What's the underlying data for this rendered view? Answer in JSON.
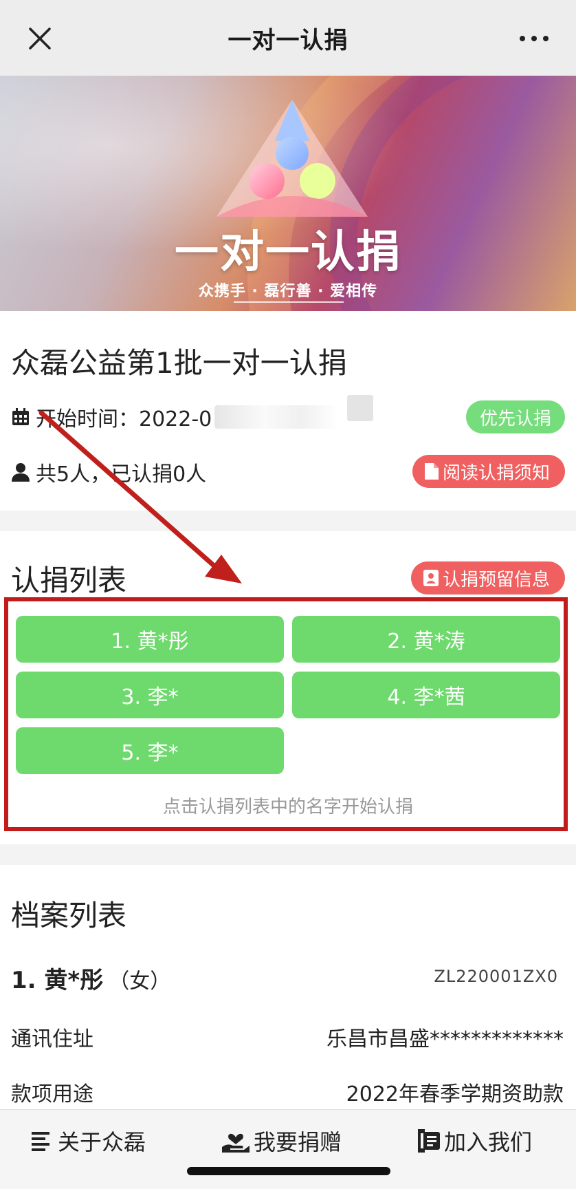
{
  "navbar": {
    "title": "一对一认捐"
  },
  "banner": {
    "title": "一对一认捐",
    "slogan": "众携手 · 磊行善 · 爱相传"
  },
  "info": {
    "title": "众磊公益第1批一对一认捐",
    "start_time_label": "开始时间：2022-0",
    "priority_badge": "优先认捐",
    "count_text": "共5人，已认捐0人",
    "read_button": "阅读认捐须知"
  },
  "subscription_list": {
    "title": "认捐列表",
    "reserve_button": "认捐预留信息",
    "items": [
      "1. 黄*彤",
      "2. 黄*涛",
      "3. 李*",
      "4. 李*茜",
      "5. 李*"
    ],
    "hint": "点击认捐列表中的名字开始认捐"
  },
  "archive": {
    "title": "档案列表",
    "person": {
      "name": "1. 黄*彤",
      "gender": "（女）",
      "code": "ZL220001ZX0"
    },
    "address_label": "通讯住址",
    "address_value": "乐昌市昌盛*************",
    "usage_label": "款项用途",
    "usage_value": "2022年春季学期资助款"
  },
  "tabbar": {
    "about": "关于众磊",
    "donate": "我要捐赠",
    "join": "加入我们"
  },
  "colors": {
    "green": "#6ed96c",
    "red_button": "#f06060",
    "red_annotation": "#c21b1b"
  },
  "icons": [
    "close-icon",
    "more-icon",
    "calendar-icon",
    "person-icon",
    "document-icon",
    "contact-card-icon",
    "list-icon",
    "donate-hand-icon",
    "join-icon"
  ]
}
